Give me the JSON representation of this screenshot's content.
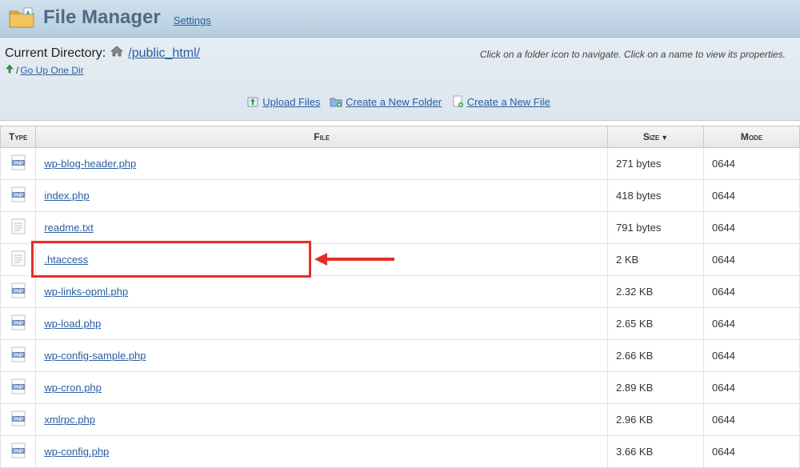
{
  "header": {
    "title": "File Manager",
    "settings_label": "Settings"
  },
  "path": {
    "current_label": "Current Directory:",
    "current_path": "/public_html/",
    "go_up_label": "Go Up One Dir",
    "hint": "Click on a folder icon to navigate. Click on a name to view its properties."
  },
  "actions": {
    "upload": "Upload Files",
    "new_folder": "Create a New Folder",
    "new_file": "Create a New File"
  },
  "table": {
    "headers": {
      "type": "Type",
      "file": "File",
      "size": "Size",
      "size_sort": "▼",
      "mode": "Mode"
    },
    "rows": [
      {
        "icon": "php",
        "name": "wp-blog-header.php",
        "size": "271 bytes",
        "mode": "0644",
        "highlight": false
      },
      {
        "icon": "php",
        "name": "index.php",
        "size": "418 bytes",
        "mode": "0644",
        "highlight": false
      },
      {
        "icon": "txt",
        "name": "readme.txt",
        "size": "791 bytes",
        "mode": "0644",
        "highlight": false
      },
      {
        "icon": "txt",
        "name": ".htaccess",
        "size": "2 KB",
        "mode": "0644",
        "highlight": true
      },
      {
        "icon": "php",
        "name": "wp-links-opml.php",
        "size": "2.32 KB",
        "mode": "0644",
        "highlight": false
      },
      {
        "icon": "php",
        "name": "wp-load.php",
        "size": "2.65 KB",
        "mode": "0644",
        "highlight": false
      },
      {
        "icon": "php",
        "name": "wp-config-sample.php",
        "size": "2.66 KB",
        "mode": "0644",
        "highlight": false
      },
      {
        "icon": "php",
        "name": "wp-cron.php",
        "size": "2.89 KB",
        "mode": "0644",
        "highlight": false
      },
      {
        "icon": "php",
        "name": "xmlrpc.php",
        "size": "2.96 KB",
        "mode": "0644",
        "highlight": false
      },
      {
        "icon": "php",
        "name": "wp-config.php",
        "size": "3.66 KB",
        "mode": "0644",
        "highlight": false
      }
    ]
  }
}
